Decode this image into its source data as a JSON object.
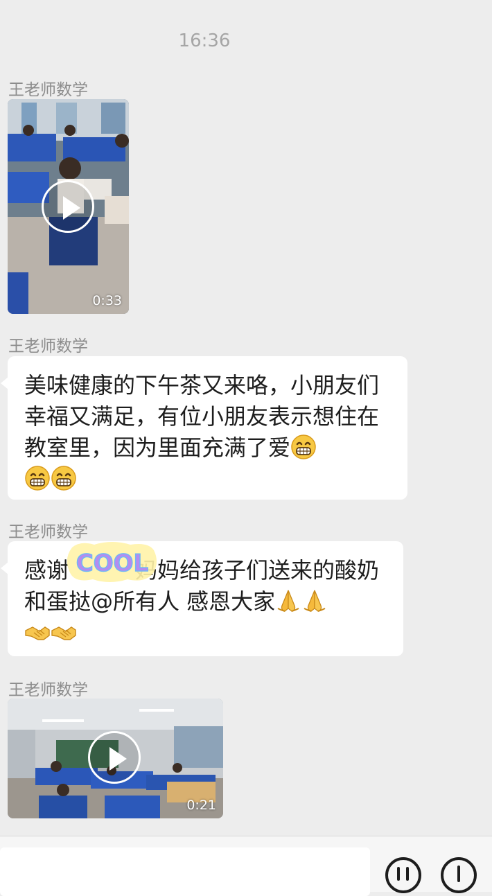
{
  "chat": {
    "timestamp": "16:36",
    "messages": [
      {
        "sender": "王老师数学",
        "type": "video",
        "duration": "0:33"
      },
      {
        "sender": "王老师数学",
        "type": "text",
        "text": "美味健康的下午茶又来咯，小朋友们幸福又满足，有位小朋友表示想住在教室里，因为里面充满了爱",
        "emojis": [
          "grin-emoji",
          "grin-emoji",
          "grin-emoji"
        ]
      },
      {
        "sender": "王老师数学",
        "type": "text",
        "text_before_sticker": "感谢",
        "text_after_sticker": "妈妈给孩子们送来的酸奶和蛋挞@所有人  感恩大家",
        "emojis": [
          "pray-hands-emoji",
          "pray-hands-emoji",
          "handshake-emoji",
          "handshake-emoji"
        ],
        "sticker": {
          "text": "COOL"
        }
      },
      {
        "sender": "王老师数学",
        "type": "video",
        "duration": "0:21"
      }
    ]
  },
  "input_bar": {
    "icons": [
      "voice-icon",
      "emoji-face-icon"
    ]
  }
}
